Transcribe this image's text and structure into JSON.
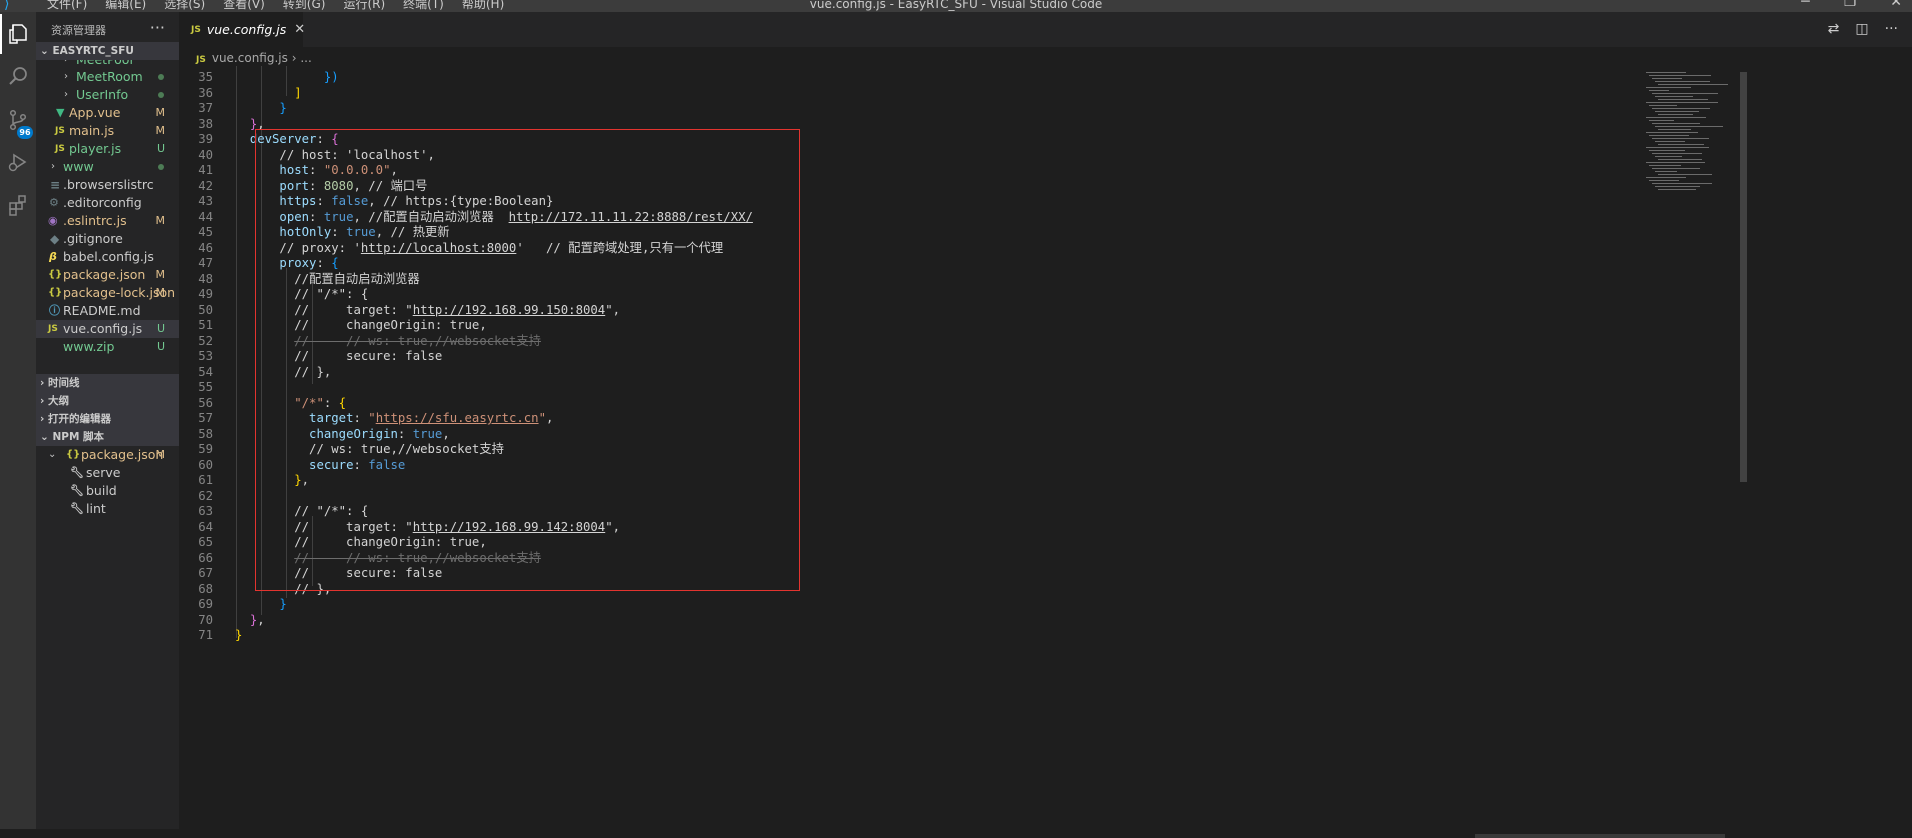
{
  "titlebar": {
    "menu": [
      "文件(F)",
      "编辑(E)",
      "选择(S)",
      "查看(V)",
      "转到(G)",
      "运行(R)",
      "终端(T)",
      "帮助(H)"
    ],
    "title": "vue.config.js - EasyRTC_SFU - Visual Studio Code",
    "controls": [
      "─",
      "❐",
      "✕"
    ]
  },
  "activity_bar": {
    "scm_badge": "96"
  },
  "sidebar": {
    "header": "资源管理器",
    "more": "···",
    "project": "EASYRTC_SFU",
    "files": [
      {
        "name": "MeetPool",
        "status": "●"
      },
      {
        "name": "MeetRoom",
        "status": "●"
      },
      {
        "name": "UserInfo",
        "status": "●"
      },
      {
        "name": "App.vue",
        "status": "M"
      },
      {
        "name": "main.js",
        "status": "M"
      },
      {
        "name": "player.js",
        "status": "U"
      },
      {
        "name": "www",
        "status": "●"
      },
      {
        "name": ".browserslistrc",
        "status": ""
      },
      {
        "name": ".editorconfig",
        "status": ""
      },
      {
        "name": ".eslintrc.js",
        "status": "M"
      },
      {
        "name": ".gitignore",
        "status": ""
      },
      {
        "name": "babel.config.js",
        "status": ""
      },
      {
        "name": "package.json",
        "status": "M"
      },
      {
        "name": "package-lock.json",
        "status": "M"
      },
      {
        "name": "README.md",
        "status": ""
      },
      {
        "name": "vue.config.js",
        "status": "U"
      },
      {
        "name": "www.zip",
        "status": "U"
      }
    ],
    "sections": [
      "时间线",
      "大纲",
      "打开的编辑器",
      "NPM 脚本"
    ],
    "npm": {
      "package": "package.json",
      "package_status": "M",
      "scripts": [
        "serve",
        "build",
        "lint"
      ]
    }
  },
  "editor": {
    "tab": "vue.config.js",
    "tab_badge": "JS",
    "breadcrumb_file": "vue.config.js",
    "breadcrumb_rest": "...",
    "line_numbers": [
      "35",
      "36",
      "37",
      "38",
      "39",
      "40",
      "41",
      "42",
      "43",
      "44",
      "45",
      "46",
      "47",
      "48",
      "49",
      "50",
      "51",
      "52",
      "53",
      "54",
      "55",
      "56",
      "57",
      "58",
      "59",
      "60",
      "61",
      "62",
      "63",
      "64",
      "65",
      "66",
      "67",
      "68",
      "69",
      "70",
      "71"
    ],
    "code": {
      "l40": "// host: 'localhost',",
      "l41_key": "host",
      "l41_val": "\"0.0.0.0\"",
      "l42_key": "port",
      "l42_val": "8080",
      "l42_c": "// 端口号",
      "l43_key": "https",
      "l43_val": "false",
      "l43_c": "// https:{type:Boolean}",
      "l44_key": "open",
      "l44_val": "true",
      "l44_c": "//配置自动启动浏览器",
      "l44_url": "http://172.11.11.22:8888/rest/XX/",
      "l45_key": "hotOnly",
      "l45_val": "true",
      "l45_c": "// 热更新",
      "l46_a": "// proxy: '",
      "l46_url": "http://localhost:8000",
      "l46_b": "'   // 配置跨域处理,只有一个代理",
      "l47_key": "proxy",
      "l48": "//配置自动启动浏览器",
      "l49": "// \"/*\": {",
      "l50_a": "//     target: \"",
      "l50_url": "http://192.168.99.150:8004",
      "l50_b": "\",",
      "l51": "//     changeOrigin: true,",
      "l52": "//     // ws: true,//websocket支持",
      "l53": "//     secure: false",
      "l54": "// },",
      "l56_key": "\"/*\"",
      "l57_key": "target",
      "l57_q1": "\"",
      "l57_url": "https://sfu.easyrtc.cn",
      "l57_q2": "\"",
      "l58_key": "changeOrigin",
      "l58_val": "true",
      "l59": "// ws: true,//websocket支持",
      "l60_key": "secure",
      "l60_val": "false",
      "l63": "// \"/*\": {",
      "l64_a": "//     target: \"",
      "l64_url": "http://192.168.99.142:8004",
      "l64_b": "\",",
      "l65": "//     changeOrigin: true,",
      "l66": "//     // ws: true,//websocket支持",
      "l67": "//     secure: false",
      "l68": "// },",
      "l39_key": "devServer"
    }
  },
  "colors": {
    "highlight_box": "#e3342f",
    "activity_bar": "#333333",
    "sidebar": "#252526",
    "editor": "#1e1e1e"
  }
}
